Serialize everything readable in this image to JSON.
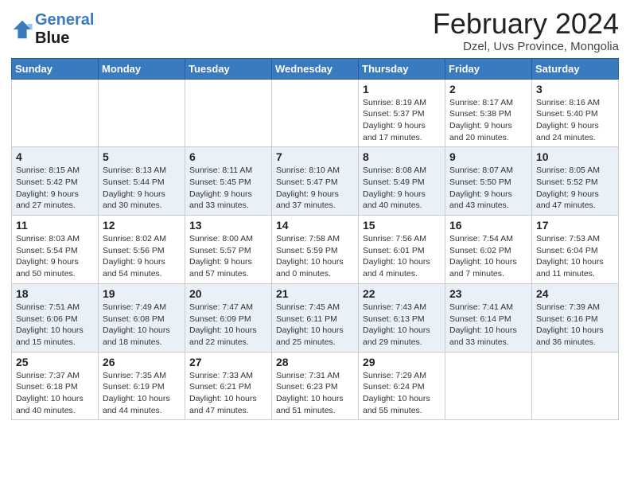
{
  "header": {
    "logo_line1": "General",
    "logo_line2": "Blue",
    "title": "February 2024",
    "subtitle": "Dzel, Uvs Province, Mongolia"
  },
  "days_of_week": [
    "Sunday",
    "Monday",
    "Tuesday",
    "Wednesday",
    "Thursday",
    "Friday",
    "Saturday"
  ],
  "weeks": [
    [
      {
        "day": "",
        "info": ""
      },
      {
        "day": "",
        "info": ""
      },
      {
        "day": "",
        "info": ""
      },
      {
        "day": "",
        "info": ""
      },
      {
        "day": "1",
        "info": "Sunrise: 8:19 AM\nSunset: 5:37 PM\nDaylight: 9 hours and 17 minutes."
      },
      {
        "day": "2",
        "info": "Sunrise: 8:17 AM\nSunset: 5:38 PM\nDaylight: 9 hours and 20 minutes."
      },
      {
        "day": "3",
        "info": "Sunrise: 8:16 AM\nSunset: 5:40 PM\nDaylight: 9 hours and 24 minutes."
      }
    ],
    [
      {
        "day": "4",
        "info": "Sunrise: 8:15 AM\nSunset: 5:42 PM\nDaylight: 9 hours and 27 minutes."
      },
      {
        "day": "5",
        "info": "Sunrise: 8:13 AM\nSunset: 5:44 PM\nDaylight: 9 hours and 30 minutes."
      },
      {
        "day": "6",
        "info": "Sunrise: 8:11 AM\nSunset: 5:45 PM\nDaylight: 9 hours and 33 minutes."
      },
      {
        "day": "7",
        "info": "Sunrise: 8:10 AM\nSunset: 5:47 PM\nDaylight: 9 hours and 37 minutes."
      },
      {
        "day": "8",
        "info": "Sunrise: 8:08 AM\nSunset: 5:49 PM\nDaylight: 9 hours and 40 minutes."
      },
      {
        "day": "9",
        "info": "Sunrise: 8:07 AM\nSunset: 5:50 PM\nDaylight: 9 hours and 43 minutes."
      },
      {
        "day": "10",
        "info": "Sunrise: 8:05 AM\nSunset: 5:52 PM\nDaylight: 9 hours and 47 minutes."
      }
    ],
    [
      {
        "day": "11",
        "info": "Sunrise: 8:03 AM\nSunset: 5:54 PM\nDaylight: 9 hours and 50 minutes."
      },
      {
        "day": "12",
        "info": "Sunrise: 8:02 AM\nSunset: 5:56 PM\nDaylight: 9 hours and 54 minutes."
      },
      {
        "day": "13",
        "info": "Sunrise: 8:00 AM\nSunset: 5:57 PM\nDaylight: 9 hours and 57 minutes."
      },
      {
        "day": "14",
        "info": "Sunrise: 7:58 AM\nSunset: 5:59 PM\nDaylight: 10 hours and 0 minutes."
      },
      {
        "day": "15",
        "info": "Sunrise: 7:56 AM\nSunset: 6:01 PM\nDaylight: 10 hours and 4 minutes."
      },
      {
        "day": "16",
        "info": "Sunrise: 7:54 AM\nSunset: 6:02 PM\nDaylight: 10 hours and 7 minutes."
      },
      {
        "day": "17",
        "info": "Sunrise: 7:53 AM\nSunset: 6:04 PM\nDaylight: 10 hours and 11 minutes."
      }
    ],
    [
      {
        "day": "18",
        "info": "Sunrise: 7:51 AM\nSunset: 6:06 PM\nDaylight: 10 hours and 15 minutes."
      },
      {
        "day": "19",
        "info": "Sunrise: 7:49 AM\nSunset: 6:08 PM\nDaylight: 10 hours and 18 minutes."
      },
      {
        "day": "20",
        "info": "Sunrise: 7:47 AM\nSunset: 6:09 PM\nDaylight: 10 hours and 22 minutes."
      },
      {
        "day": "21",
        "info": "Sunrise: 7:45 AM\nSunset: 6:11 PM\nDaylight: 10 hours and 25 minutes."
      },
      {
        "day": "22",
        "info": "Sunrise: 7:43 AM\nSunset: 6:13 PM\nDaylight: 10 hours and 29 minutes."
      },
      {
        "day": "23",
        "info": "Sunrise: 7:41 AM\nSunset: 6:14 PM\nDaylight: 10 hours and 33 minutes."
      },
      {
        "day": "24",
        "info": "Sunrise: 7:39 AM\nSunset: 6:16 PM\nDaylight: 10 hours and 36 minutes."
      }
    ],
    [
      {
        "day": "25",
        "info": "Sunrise: 7:37 AM\nSunset: 6:18 PM\nDaylight: 10 hours and 40 minutes."
      },
      {
        "day": "26",
        "info": "Sunrise: 7:35 AM\nSunset: 6:19 PM\nDaylight: 10 hours and 44 minutes."
      },
      {
        "day": "27",
        "info": "Sunrise: 7:33 AM\nSunset: 6:21 PM\nDaylight: 10 hours and 47 minutes."
      },
      {
        "day": "28",
        "info": "Sunrise: 7:31 AM\nSunset: 6:23 PM\nDaylight: 10 hours and 51 minutes."
      },
      {
        "day": "29",
        "info": "Sunrise: 7:29 AM\nSunset: 6:24 PM\nDaylight: 10 hours and 55 minutes."
      },
      {
        "day": "",
        "info": ""
      },
      {
        "day": "",
        "info": ""
      }
    ]
  ]
}
